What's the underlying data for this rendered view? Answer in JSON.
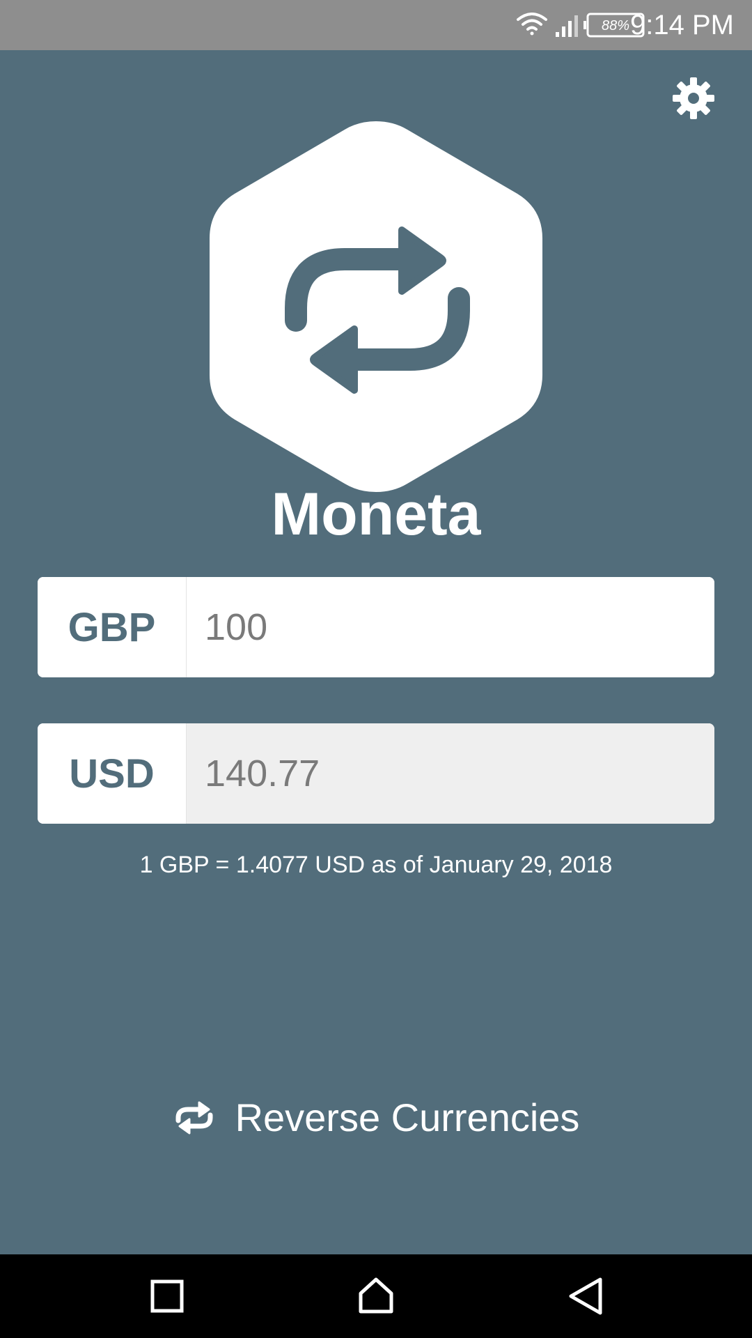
{
  "status_bar": {
    "battery": "88%",
    "time": "9:14 PM"
  },
  "app": {
    "title": "Moneta",
    "settings_icon": "gear-icon",
    "logo_icon": "repeat-arrows-icon"
  },
  "from_currency": {
    "code": "GBP",
    "amount": "100"
  },
  "to_currency": {
    "code": "USD",
    "amount": "140.77"
  },
  "rate_text": "1 GBP = 1.4077 USD as of January 29, 2018",
  "reverse": {
    "label": "Reverse Currencies",
    "icon": "repeat-icon"
  },
  "nav": {
    "recents_icon": "square-icon",
    "home_icon": "home-icon",
    "back_icon": "back-triangle-icon"
  },
  "colors": {
    "background": "#526d7b",
    "status_bar": "#8e8e8e",
    "output_field": "#efefef",
    "text_muted": "#7a7a7a"
  }
}
